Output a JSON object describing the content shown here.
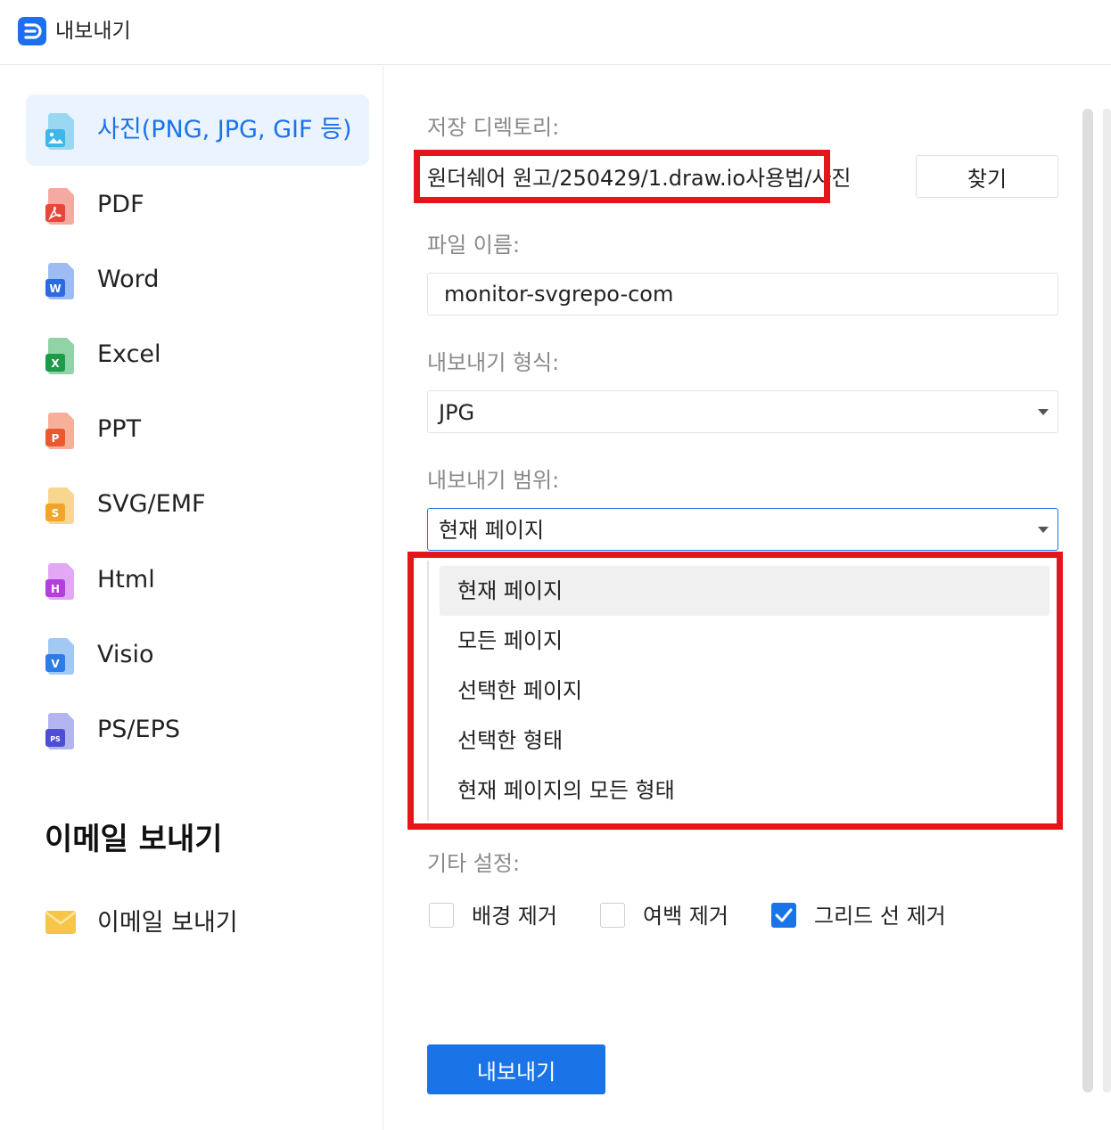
{
  "window": {
    "title": "내보내기"
  },
  "sidebar": {
    "items": [
      {
        "label": "사진(PNG, JPG, GIF 등)",
        "icon": "image-file-icon",
        "color": "#3fb6e8",
        "active": true
      },
      {
        "label": "PDF",
        "icon": "pdf-file-icon",
        "color": "#e5483a"
      },
      {
        "label": "Word",
        "icon": "word-file-icon",
        "color": "#2b6ae0"
      },
      {
        "label": "Excel",
        "icon": "excel-file-icon",
        "color": "#1e9a4b"
      },
      {
        "label": "PPT",
        "icon": "ppt-file-icon",
        "color": "#ea5a2f"
      },
      {
        "label": "SVG/EMF",
        "icon": "svg-file-icon",
        "color": "#f0a52a"
      },
      {
        "label": "Html",
        "icon": "html-file-icon",
        "color": "#b43fdf"
      },
      {
        "label": "Visio",
        "icon": "visio-file-icon",
        "color": "#2e7ce6"
      },
      {
        "label": "PS/EPS",
        "icon": "ps-file-icon",
        "color": "#4d4ed6"
      }
    ],
    "email_section_title": "이메일 보내기",
    "email_item": {
      "label": "이메일 보내기",
      "icon": "envelope-icon"
    }
  },
  "form": {
    "save_dir_label": "저장 디렉토리:",
    "save_dir_value": "원더쉐어 원고/250429/1.draw.io사용법/사진",
    "browse_label": "찾기",
    "file_name_label": "파일 이름:",
    "file_name_value": "monitor-svgrepo-com",
    "format_label": "내보내기 형식:",
    "format_value": "JPG",
    "range_label": "내보내기 범위:",
    "range_value": "현재 페이지",
    "range_options": [
      "현재 페이지",
      "모든 페이지",
      "선택한 페이지",
      "선택한 형태",
      "현재 페이지의 모든 형태"
    ],
    "other_label": "기타 설정:",
    "checkboxes": [
      {
        "label": "배경 제거",
        "checked": false
      },
      {
        "label": "여백 제거",
        "checked": false
      },
      {
        "label": "그리드 선 제거",
        "checked": true
      }
    ],
    "export_label": "내보내기"
  },
  "colors": {
    "accent": "#1b73e8",
    "highlight": "#e4161c"
  }
}
